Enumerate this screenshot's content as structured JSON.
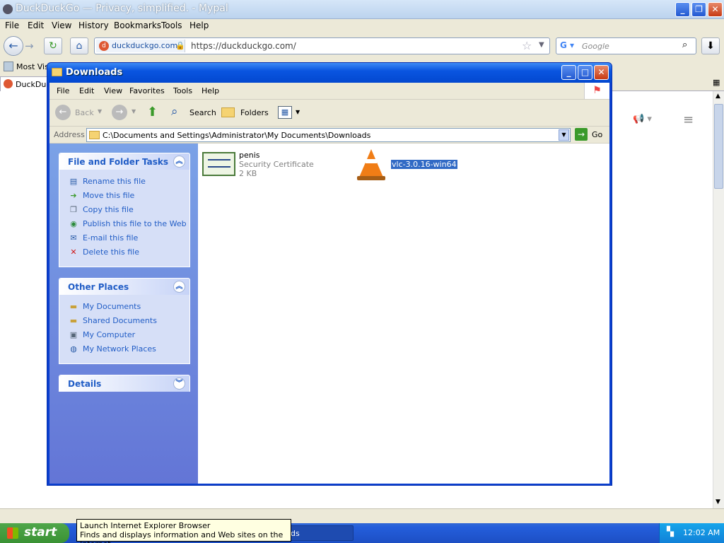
{
  "browser": {
    "title": "DuckDuckGo — Privacy, simplified. - Mypal",
    "menu": [
      "File",
      "Edit",
      "View",
      "History",
      "Bookmarks",
      "Tools",
      "Help"
    ],
    "identity_host": "duckduckgo.com",
    "url": "https://duckduckgo.com/",
    "search_placeholder": "Google",
    "bookmark_partial": "Most Visi",
    "tab_partial": "DuckDuck"
  },
  "explorer": {
    "title": "Downloads",
    "menu": [
      "File",
      "Edit",
      "View",
      "Favorites",
      "Tools",
      "Help"
    ],
    "toolbar": {
      "back": "Back",
      "search": "Search",
      "folders": "Folders"
    },
    "address_label": "Address",
    "address_path": "C:\\Documents and Settings\\Administrator\\My Documents\\Downloads",
    "go_label": "Go",
    "file_tasks": {
      "title": "File and Folder Tasks",
      "items": [
        "Rename this file",
        "Move this file",
        "Copy this file",
        "Publish this file to the Web",
        "E-mail this file",
        "Delete this file"
      ]
    },
    "other_places": {
      "title": "Other Places",
      "items": [
        "My Documents",
        "Shared Documents",
        "My Computer",
        "My Network Places"
      ]
    },
    "details": {
      "title": "Details"
    },
    "files": [
      {
        "name": "penis",
        "type": "Security Certificate",
        "size": "2 KB",
        "icon": "certificate-icon"
      },
      {
        "name": "vlc-3.0.16-win64",
        "icon": "vlc-cone-icon",
        "selected": true
      }
    ]
  },
  "taskbar": {
    "start_label": "start",
    "task_partial": "ds",
    "clock": "12:02 AM"
  },
  "tooltip": {
    "line1": "Launch Internet Explorer Browser",
    "line2": "Finds and displays information and Web sites on the Internet."
  },
  "colors": {
    "xp_blue": "#0a55e0",
    "start_green": "#3a9234",
    "task_link": "#215dc6",
    "selection": "#316ac5"
  }
}
